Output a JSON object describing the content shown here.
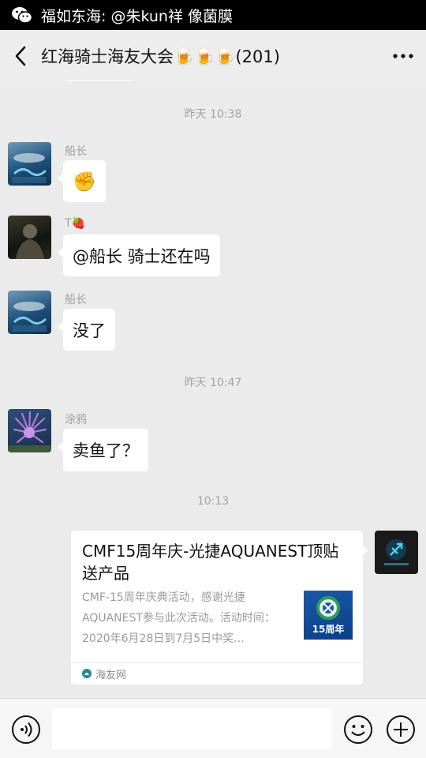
{
  "notification": {
    "app_icon": "wechat-icon",
    "text": "福如东海: @朱kun祥 像菌膜"
  },
  "header": {
    "back_icon": "chevron-left-icon",
    "title": "红海骑士海友大会🍺🍺🍺(201)",
    "more_icon": "more-dots-icon"
  },
  "chat": {
    "timestamps": [
      "昨天 10:38",
      "昨天 10:47",
      "10:13"
    ],
    "messages": [
      {
        "sender": "船长",
        "text": "✊",
        "avatar_icon": "red-sea-coral-avatar-icon"
      },
      {
        "sender": "T🍓",
        "text": "@船长  骑士还在吗",
        "avatar_icon": "dark-portrait-avatar-icon"
      },
      {
        "sender": "船长",
        "text": "没了",
        "avatar_icon": "red-sea-coral-avatar-icon"
      },
      {
        "sender": "涂鸦",
        "text": "卖鱼了？",
        "avatar_icon": "purple-coral-avatar-icon"
      }
    ],
    "link_card": {
      "title": "CMF15周年庆-光捷AQUANEST顶贴送产品",
      "description": "CMF-15周年庆典活动，感谢光捷AQUANEST参与此次活动。活动时间：2020年6月28日到7月5日中奖...",
      "thumbnail_text": "15周年",
      "source": "海友网",
      "source_icon": "haiyou-logo-icon",
      "sender_avatar_icon": "sagittarius-avatar-icon"
    }
  },
  "input_bar": {
    "voice_icon": "voice-icon",
    "input_value": "",
    "emoji_icon": "emoji-icon",
    "plus_icon": "plus-icon"
  },
  "colors": {
    "background": "#ebebeb",
    "bubble": "#ffffff",
    "timestamp": "#a3a3a3"
  }
}
